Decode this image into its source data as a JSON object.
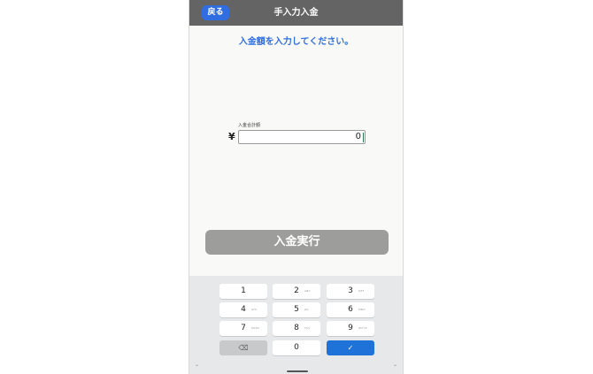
{
  "header": {
    "back_label": "戻る",
    "title": "手入力入金"
  },
  "main": {
    "instruction": "入金額を入力してください。",
    "amount_label": "入金合計額",
    "currency_symbol": "¥",
    "amount_value": "0",
    "execute_label": "入金実行"
  },
  "keypad": {
    "keys": [
      {
        "num": "1",
        "letters": ""
      },
      {
        "num": "2",
        "letters": "ABC"
      },
      {
        "num": "3",
        "letters": "DEF"
      },
      {
        "num": "4",
        "letters": "GHI"
      },
      {
        "num": "5",
        "letters": "JKL"
      },
      {
        "num": "6",
        "letters": "MNO"
      },
      {
        "num": "7",
        "letters": "PQRS"
      },
      {
        "num": "8",
        "letters": "TUV"
      },
      {
        "num": "9",
        "letters": "WXYZ"
      },
      {
        "num": "⌫",
        "letters": ""
      },
      {
        "num": "0",
        "letters": ""
      },
      {
        "num": "✓",
        "letters": ""
      }
    ],
    "chevron_left": "⌄",
    "chevron_right": "⌄"
  },
  "colors": {
    "accent": "#2f6de0",
    "appbar": "#646464",
    "execute_disabled": "#9d9d9b",
    "done_key": "#1f73d8"
  }
}
